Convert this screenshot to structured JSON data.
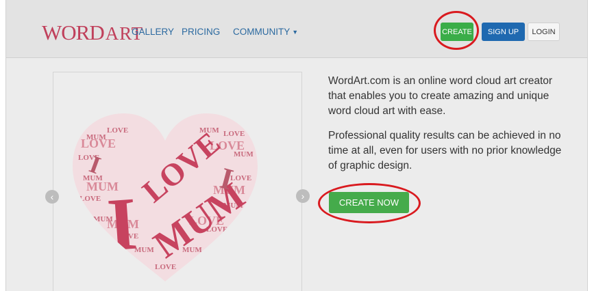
{
  "header": {
    "logo_text_1": "WORD",
    "logo_text_2": "ART",
    "nav": {
      "gallery": "GALLERY",
      "pricing": "PRICING",
      "community": "COMMUNITY"
    },
    "buttons": {
      "create": "CREATE",
      "signup": "SIGN UP",
      "login": "LOGIN"
    }
  },
  "hero": {
    "paragraph_1": "WordArt.com is an online word cloud art creator that enables you to create amazing and unique word cloud art with ease.",
    "paragraph_2": "Professional quality results can be achieved in no time at all, even for users with no prior knowledge of graphic design.",
    "cta": "CREATE NOW"
  },
  "carousel": {
    "big_words": [
      "I",
      "LOVE",
      "MUM"
    ],
    "fill_words": [
      "LOVE",
      "MUM",
      "I"
    ]
  },
  "colors": {
    "accent_red": "#d91a1f",
    "brand_pink": "#c0405b",
    "green": "#3aad48",
    "blue": "#1f69b0"
  },
  "icons": {
    "prev": "chevron-left-icon",
    "next": "chevron-right-icon",
    "dropdown": "caret-down-icon"
  }
}
